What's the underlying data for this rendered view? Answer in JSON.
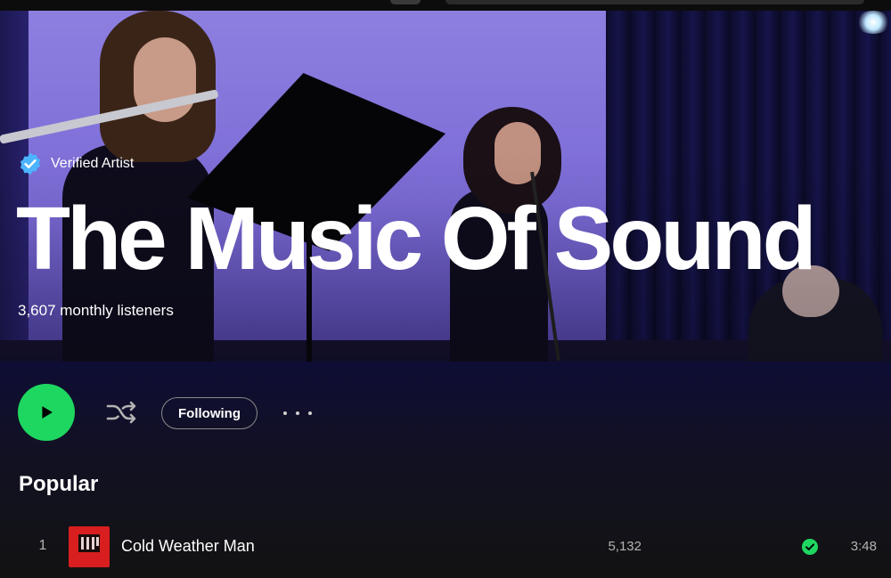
{
  "artist": {
    "verified_label": "Verified Artist",
    "name": "The Music Of Sound",
    "monthly_listeners": "3,607 monthly listeners"
  },
  "controls": {
    "follow_label": "Following"
  },
  "popular": {
    "heading": "Popular",
    "tracks": [
      {
        "rank": "1",
        "title": "Cold Weather Man",
        "plays": "5,132",
        "duration": "3:48",
        "saved": true
      }
    ]
  },
  "colors": {
    "accent": "#1ed760",
    "verified_badge": "#4cb3ff",
    "background": "#121212",
    "cover_art": "#d81e1e"
  },
  "icons": [
    "verified-badge-icon",
    "play-icon",
    "shuffle-icon",
    "more-options-icon",
    "saved-check-icon"
  ]
}
